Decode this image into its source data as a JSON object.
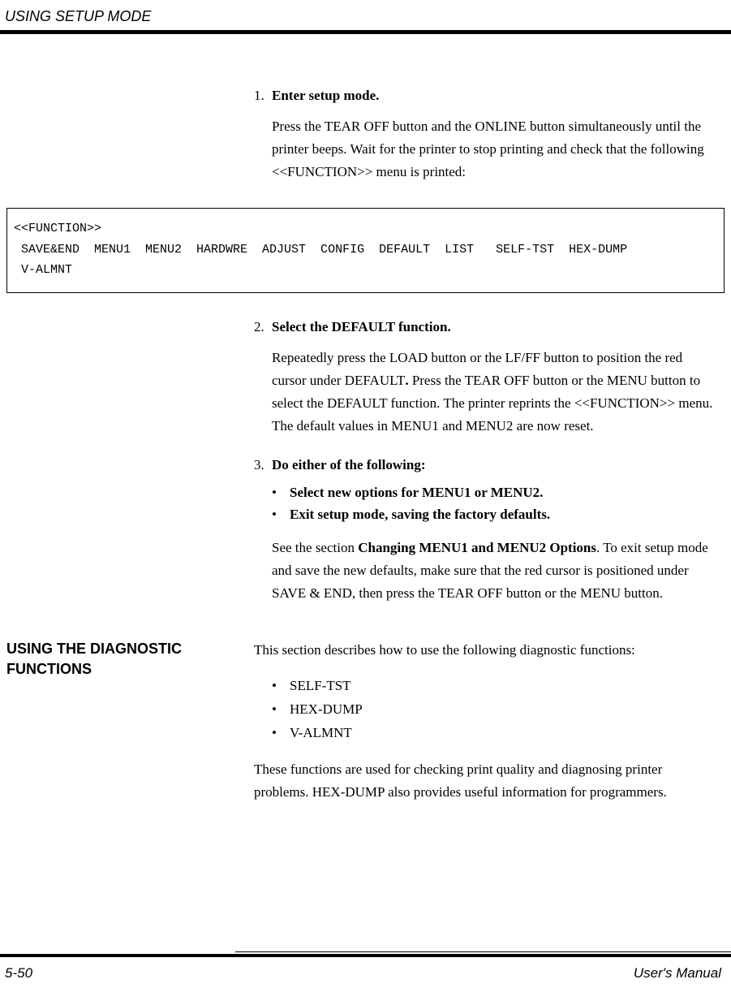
{
  "header": {
    "running_head": "USING SETUP MODE"
  },
  "steps": {
    "s1": {
      "num": "1.",
      "title": "Enter setup mode.",
      "body": "Press the TEAR OFF button and the ONLINE button simultaneously until the printer beeps.  Wait for the printer to stop printing and check that the following <<FUNCTION>> menu is printed:"
    },
    "function_box": {
      "line1": "<<FUNCTION>>",
      "line2": " SAVE&END  MENU1  MENU2  HARDWRE  ADJUST  CONFIG  DEFAULT  LIST   SELF-TST  HEX-DUMP",
      "line3": " V-ALMNT"
    },
    "s2": {
      "num": "2.",
      "title": "Select the DEFAULT function.",
      "body_a": "Repeatedly press the LOAD button or the LF/FF button to position the red cursor under DEFAULT",
      "body_dot": ".",
      "body_b": "  Press the TEAR OFF button or the MENU button to select the DEFAULT function.  The printer reprints the <<FUNCTION>> menu.  The default values in MENU1 and MENU2 are now reset."
    },
    "s3": {
      "num": "3.",
      "title": "Do either of the following:",
      "bullets": {
        "b1": "Select new options for MENU1 or MENU2.",
        "b2": "Exit setup mode, saving the factory defaults."
      },
      "after_a": "See the section ",
      "after_bold": "Changing MENU1 and MENU2 Options",
      "after_b": ".  To exit setup mode and save the new defaults, make sure that the red cursor is positioned under SAVE & END, then press the TEAR OFF button or the MENU button."
    }
  },
  "diagnostic": {
    "heading_l1": "USING THE DIAGNOSTIC",
    "heading_l2": "FUNCTIONS",
    "intro": "This section describes how to use the following diagnostic functions:",
    "items": {
      "i1": "SELF-TST",
      "i2": "HEX-DUMP",
      "i3": "V-ALMNT"
    },
    "outro": "These functions are used for checking print quality and diagnosing printer problems.  HEX-DUMP also provides useful information for programmers."
  },
  "footer": {
    "page": "5-50",
    "manual": "User's Manual"
  },
  "glyphs": {
    "bullet": "•"
  }
}
